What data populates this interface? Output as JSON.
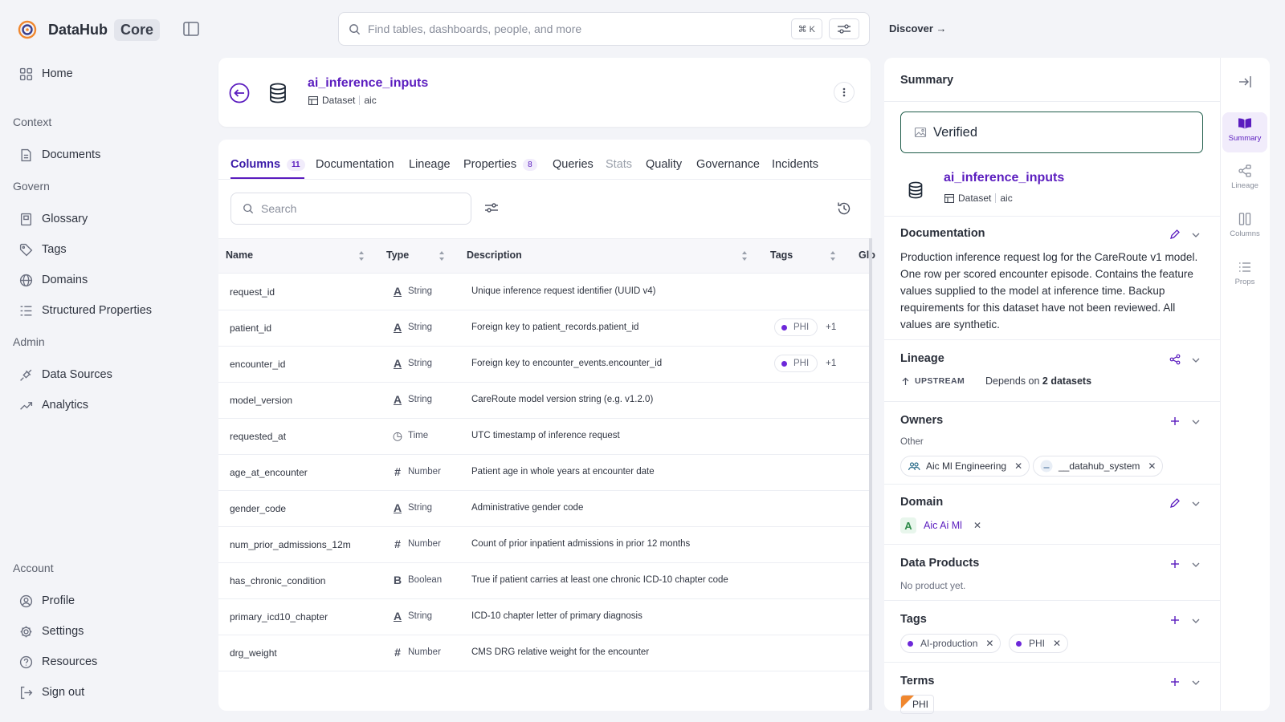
{
  "brand": {
    "name": "DataHub",
    "edition": "Core"
  },
  "sidebar": {
    "home": "Home",
    "sections": {
      "context": "Context",
      "govern": "Govern",
      "admin": "Admin",
      "account": "Account"
    },
    "context_items": [
      "Documents"
    ],
    "govern_items": [
      "Glossary",
      "Tags",
      "Domains",
      "Structured Properties"
    ],
    "admin_items": [
      "Data Sources",
      "Analytics"
    ],
    "account_items": [
      "Profile",
      "Settings",
      "Resources",
      "Sign out"
    ]
  },
  "search": {
    "placeholder": "Find tables, dashboards, people, and more",
    "shortcut": "⌘ K"
  },
  "discover": "Discover →",
  "entity": {
    "name": "ai_inference_inputs",
    "type": "Dataset",
    "platform": "aic"
  },
  "tabs": [
    {
      "label": "Columns",
      "count": "11"
    },
    {
      "label": "Documentation"
    },
    {
      "label": "Lineage"
    },
    {
      "label": "Properties",
      "count": "8"
    },
    {
      "label": "Queries"
    },
    {
      "label": "Stats"
    },
    {
      "label": "Quality"
    },
    {
      "label": "Governance"
    },
    {
      "label": "Incidents"
    }
  ],
  "columns_search_placeholder": "Search",
  "table": {
    "headers": [
      "Name",
      "Type",
      "Description",
      "Tags",
      "Glo"
    ],
    "rows": [
      {
        "name": "request_id",
        "type": "String",
        "type_icon": "string-icon",
        "description": "Unique inference request identifier (UUID v4)",
        "tag": "",
        "extra": ""
      },
      {
        "name": "patient_id",
        "type": "String",
        "type_icon": "string-icon",
        "description": "Foreign key to patient_records.patient_id",
        "tag": "PHI",
        "extra": "+1"
      },
      {
        "name": "encounter_id",
        "type": "String",
        "type_icon": "string-icon",
        "description": "Foreign key to encounter_events.encounter_id",
        "tag": "PHI",
        "extra": "+1"
      },
      {
        "name": "model_version",
        "type": "String",
        "type_icon": "string-icon",
        "description": "CareRoute model version string (e.g. v1.2.0)",
        "tag": "",
        "extra": ""
      },
      {
        "name": "requested_at",
        "type": "Time",
        "type_icon": "clock-icon",
        "description": "UTC timestamp of inference request",
        "tag": "",
        "extra": ""
      },
      {
        "name": "age_at_encounter",
        "type": "Number",
        "type_icon": "number-icon",
        "description": "Patient age in whole years at encounter date",
        "tag": "",
        "extra": ""
      },
      {
        "name": "gender_code",
        "type": "String",
        "type_icon": "string-icon",
        "description": "Administrative gender code",
        "tag": "",
        "extra": ""
      },
      {
        "name": "num_prior_admissions_12m",
        "type": "Number",
        "type_icon": "number-icon",
        "description": "Count of prior inpatient admissions in prior 12 months",
        "tag": "",
        "extra": ""
      },
      {
        "name": "has_chronic_condition",
        "type": "Boolean",
        "type_icon": "boolean-icon",
        "description": "True if patient carries at least one chronic ICD-10 chapter code",
        "tag": "",
        "extra": ""
      },
      {
        "name": "primary_icd10_chapter",
        "type": "String",
        "type_icon": "string-icon",
        "description": "ICD-10 chapter letter of primary diagnosis",
        "tag": "",
        "extra": ""
      },
      {
        "name": "drg_weight",
        "type": "Number",
        "type_icon": "number-icon",
        "description": "CMS DRG relative weight for the encounter",
        "tag": "",
        "extra": ""
      }
    ]
  },
  "summary": {
    "title": "Summary",
    "verified": "Verified",
    "entity_name": "ai_inference_inputs",
    "entity_type": "Dataset",
    "entity_platform": "aic",
    "documentation": {
      "title": "Documentation",
      "text": "Production inference request log for the CareRoute v1 model. One row per scored encounter episode. Contains the feature values supplied to the model at inference time. Backup requirements for this dataset have not been reviewed. All values are synthetic."
    },
    "lineage": {
      "title": "Lineage",
      "direction": "UPSTREAM",
      "depends_prefix": "Depends on ",
      "depends_count": "2 datasets"
    },
    "owners": {
      "title": "Owners",
      "group": "Other",
      "items": [
        "Aic Ml Engineering",
        "__datahub_system"
      ]
    },
    "domain": {
      "title": "Domain",
      "letter": "A",
      "name": "Aic Ai Ml"
    },
    "data_products": {
      "title": "Data Products",
      "empty": "No product yet."
    },
    "tags": {
      "title": "Tags",
      "items": [
        "AI-production",
        "PHI"
      ]
    },
    "terms": {
      "title": "Terms",
      "items": [
        "PHI"
      ]
    }
  },
  "rail": [
    "Summary",
    "Lineage",
    "Columns",
    "Props"
  ],
  "colors": {
    "accent": "#5b1dbf",
    "tag_dot": "#6d28d9",
    "verified_border": "#1d5b48",
    "term_corner": "#f0872e"
  }
}
